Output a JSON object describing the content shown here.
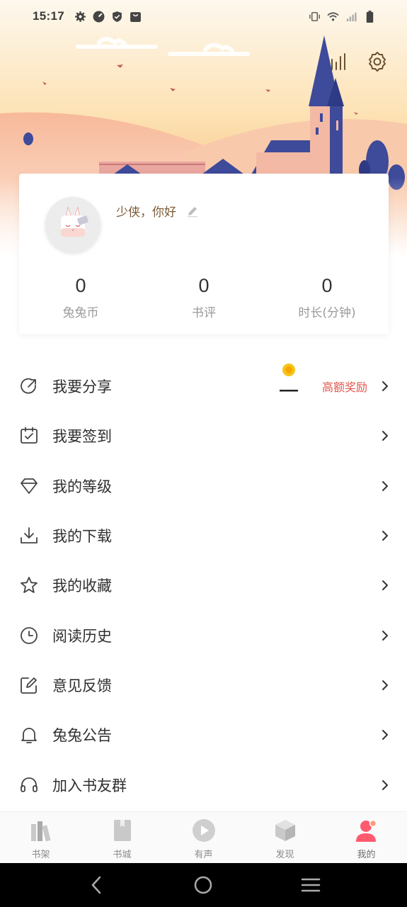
{
  "status_bar": {
    "time": "15:17",
    "left_icons": [
      "gear-icon",
      "speedometer-icon",
      "shield-icon",
      "bag-icon"
    ],
    "right_icons": [
      "vibrate-icon",
      "wifi-icon",
      "signal-icon",
      "battery-icon"
    ]
  },
  "header": {
    "actions": [
      "stats-icon",
      "settings-icon"
    ]
  },
  "profile": {
    "greeting": "少侠，你好",
    "stats": [
      {
        "value": "0",
        "label": "兔兔币"
      },
      {
        "value": "0",
        "label": "书评"
      },
      {
        "value": "0",
        "label": "时长(分钟)"
      }
    ]
  },
  "menu": {
    "items": [
      {
        "label": "我要分享",
        "icon": "share-icon",
        "badge": "高额奖励"
      },
      {
        "label": "我要签到",
        "icon": "calendar-check-icon"
      },
      {
        "label": "我的等级",
        "icon": "diamond-icon"
      },
      {
        "label": "我的下载",
        "icon": "download-icon"
      },
      {
        "label": "我的收藏",
        "icon": "star-icon"
      },
      {
        "label": "阅读历史",
        "icon": "clock-icon"
      },
      {
        "label": "意见反馈",
        "icon": "edit-icon"
      },
      {
        "label": "兔兔公告",
        "icon": "bell-icon"
      },
      {
        "label": "加入书友群",
        "icon": "headset-icon"
      }
    ]
  },
  "bottom_nav": {
    "items": [
      {
        "label": "书架",
        "icon": "bookshelf-icon"
      },
      {
        "label": "书城",
        "icon": "book-icon"
      },
      {
        "label": "有声",
        "icon": "play-icon"
      },
      {
        "label": "发现",
        "icon": "cube-icon"
      },
      {
        "label": "我的",
        "icon": "user-icon",
        "active": true
      }
    ]
  },
  "colors": {
    "accent": "#e2574c",
    "greeting": "#7a5a34",
    "sky_top": "#fdf6e8",
    "sky_bottom": "#f9c37f",
    "building": "#3e4a9a"
  }
}
